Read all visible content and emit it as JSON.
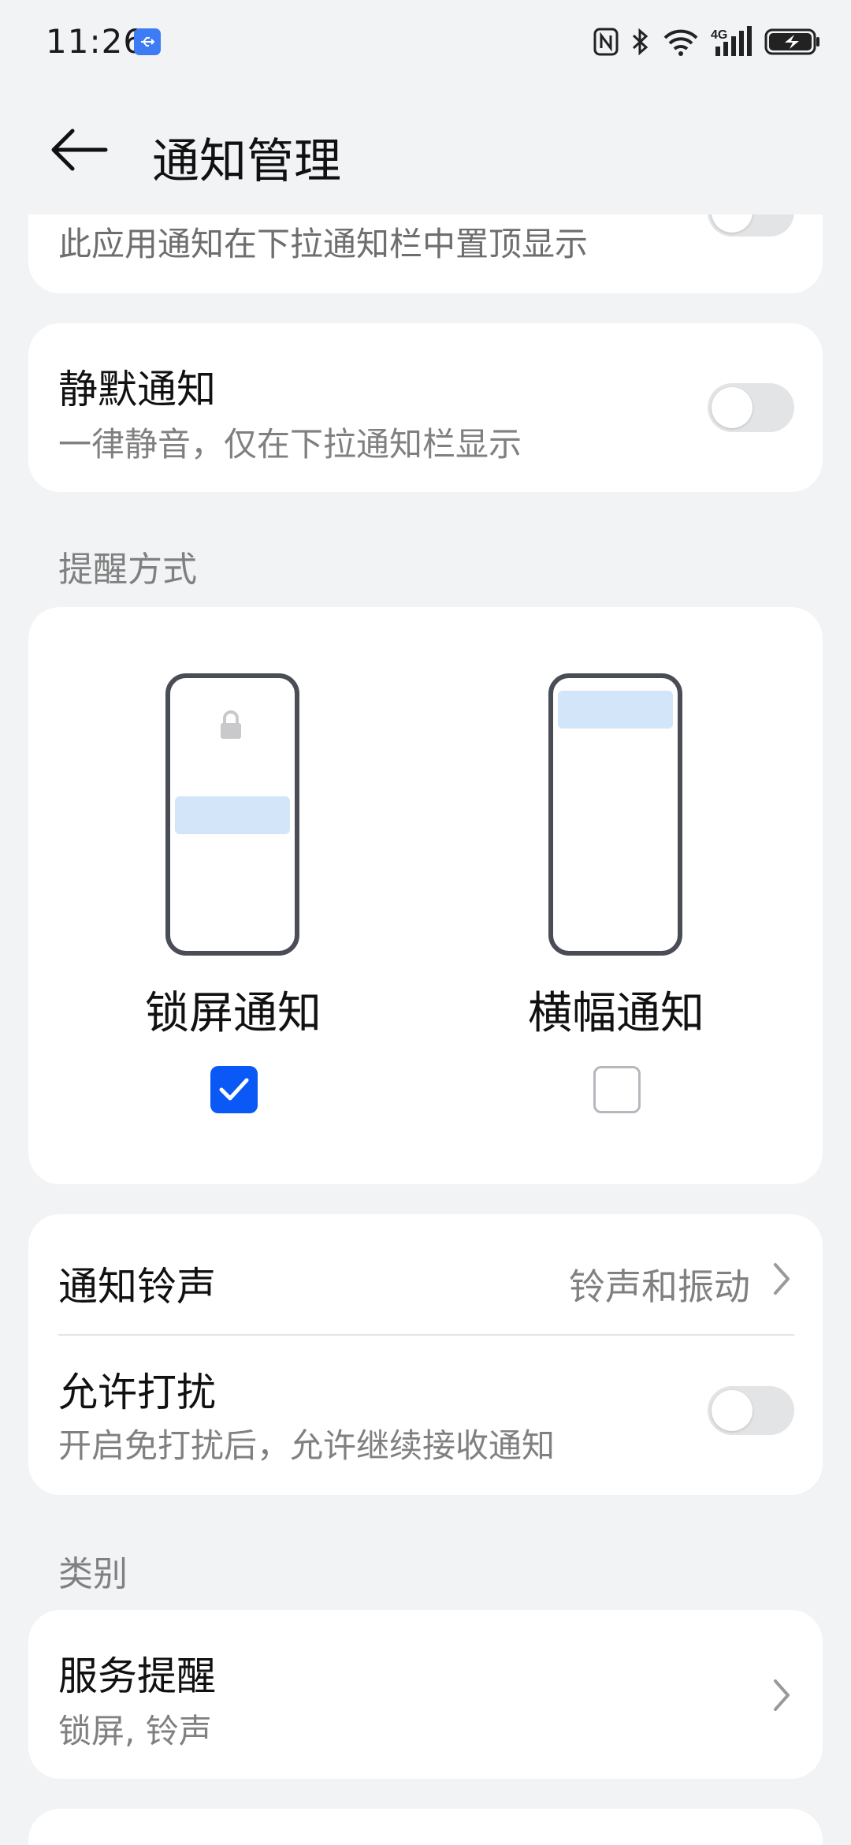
{
  "status_bar": {
    "time": "11:26",
    "icons": [
      "usb-icon",
      "nfc-icon",
      "bluetooth-icon",
      "wifi-icon",
      "signal-4g-icon",
      "battery-charging-icon"
    ],
    "network": "4G"
  },
  "header": {
    "title": "通知管理"
  },
  "pinned_card": {
    "subtitle": "此应用通知在下拉通知栏中置顶显示",
    "toggle_on": false
  },
  "silent_card": {
    "title": "静默通知",
    "subtitle": "一律静音，仅在下拉通知栏显示",
    "toggle_on": false
  },
  "reminder_section": {
    "label": "提醒方式",
    "options": [
      {
        "label": "锁屏通知",
        "checked": true
      },
      {
        "label": "横幅通知",
        "checked": false
      }
    ]
  },
  "sound_card": {
    "ringtone_title": "通知铃声",
    "ringtone_value": "铃声和振动",
    "dnd_title": "允许打扰",
    "dnd_subtitle": "开启免打扰后，允许继续接收通知",
    "dnd_toggle_on": false
  },
  "category_section": {
    "label": "类别",
    "items": [
      {
        "title": "服务提醒",
        "subtitle": "锁屏, 铃声"
      }
    ]
  },
  "colors": {
    "background": "#f1f3f5",
    "card": "#ffffff",
    "accent": "#0a59f7",
    "secondary_text": "#808080",
    "toggle_off": "#e3e4e6",
    "banner": "#d3e5f8"
  }
}
